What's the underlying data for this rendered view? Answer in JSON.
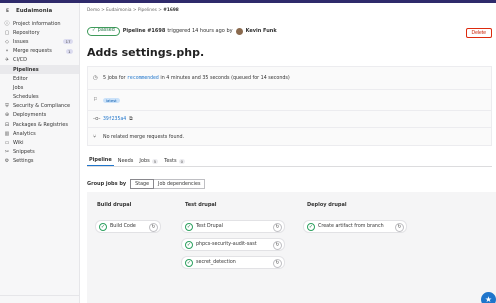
{
  "project": {
    "avatar_letter": "E",
    "name": "Eudaimonia"
  },
  "sidebar": {
    "items": [
      {
        "icon": "info-icon",
        "glyph": "ⓘ",
        "label": "Project information"
      },
      {
        "icon": "repository-icon",
        "glyph": "▢",
        "label": "Repository"
      },
      {
        "icon": "issues-icon",
        "glyph": "◇",
        "label": "Issues",
        "count": "17"
      },
      {
        "icon": "merge-request-icon",
        "glyph": "⑂",
        "label": "Merge requests",
        "count": "1"
      },
      {
        "icon": "rocket-icon",
        "glyph": "✈",
        "label": "CI/CD"
      },
      {
        "label": "Pipelines"
      },
      {
        "label": "Editor"
      },
      {
        "label": "Jobs"
      },
      {
        "label": "Schedules"
      },
      {
        "icon": "shield-icon",
        "glyph": "⛨",
        "label": "Security & Compliance"
      },
      {
        "icon": "deployments-icon",
        "glyph": "⊕",
        "label": "Deployments"
      },
      {
        "icon": "package-icon",
        "glyph": "⊟",
        "label": "Packages & Registries"
      },
      {
        "icon": "chart-icon",
        "glyph": "▥",
        "label": "Analytics"
      },
      {
        "icon": "book-icon",
        "glyph": "▭",
        "label": "Wiki"
      },
      {
        "icon": "snippet-icon",
        "glyph": "✂",
        "label": "Snippets"
      },
      {
        "icon": "gear-icon",
        "glyph": "⚙",
        "label": "Settings"
      }
    ]
  },
  "breadcrumb": {
    "group": "Demo",
    "project": "Eudaimonia",
    "section": "Pipelines",
    "current": "#1698"
  },
  "pipeline": {
    "status": "passed",
    "status_icon": "check-circle-icon",
    "label": "Pipeline #1698",
    "triggered": "triggered 14 hours ago by",
    "user": "Kevin Funk",
    "delete_label": "Delete",
    "title": "Adds settings.php."
  },
  "info": {
    "jobs_prefix": "5 jobs for",
    "branch": "recommended",
    "jobs_suffix": "in 4 minutes and 35 seconds (queued for 14 seconds)",
    "tag": "latest",
    "commit": "39f235a4",
    "merge_text": "No related merge requests found."
  },
  "tabs": [
    {
      "label": "Pipeline",
      "active": true
    },
    {
      "label": "Needs"
    },
    {
      "label": "Jobs",
      "count": "5"
    },
    {
      "label": "Tests",
      "count": "0"
    }
  ],
  "group_by": {
    "label": "Group jobs by",
    "options": [
      "Stage",
      "Job dependencies"
    ],
    "selected": "Stage"
  },
  "stages": [
    {
      "name": "Build drupal",
      "jobs": [
        "Build Code"
      ]
    },
    {
      "name": "Test drupal",
      "jobs": [
        "Test Drupal",
        "phpcs-security-audit-sast",
        "secret_detection"
      ]
    },
    {
      "name": "Deploy drupal",
      "jobs": [
        "Create artifact from branch"
      ]
    }
  ],
  "colors": {
    "accent": "#1f75cb",
    "success": "#217645",
    "danger": "#dd2b0e",
    "topbar": "#2f2a6b"
  }
}
